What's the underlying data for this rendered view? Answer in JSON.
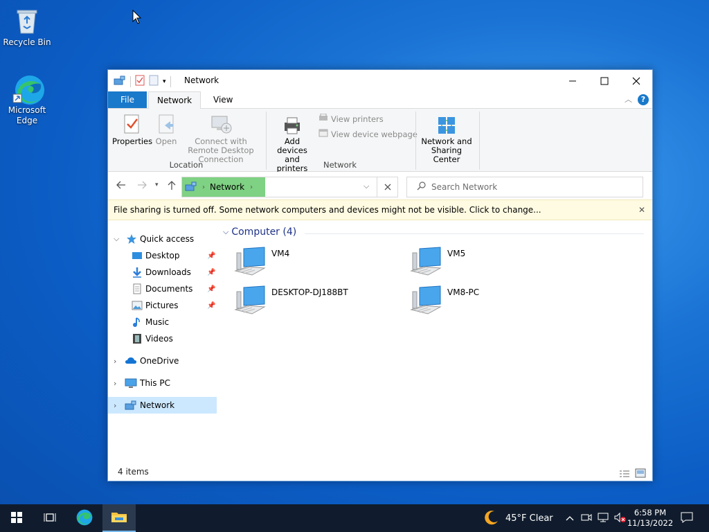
{
  "desktop": {
    "icons": [
      {
        "label": "Recycle Bin"
      },
      {
        "label": "Microsoft Edge"
      }
    ]
  },
  "window": {
    "title": "Network",
    "tabs": {
      "file": "File",
      "network": "Network",
      "view": "View"
    },
    "ribbon": {
      "properties": "Properties",
      "open": "Open",
      "connect_rdc": "Connect with Remote Desktop Connection",
      "location_group": "Location",
      "add_devices": "Add devices and printers",
      "view_printers": "View printers",
      "view_device_webpage": "View device webpage",
      "network_group": "Network",
      "network_sharing": "Network and Sharing Center"
    },
    "address": {
      "crumb": "Network",
      "search_placeholder": "Search Network"
    },
    "infobar": "File sharing is turned off. Some network computers and devices might not be visible. Click to change...",
    "nav": [
      {
        "label": "Quick access"
      },
      {
        "label": "Desktop"
      },
      {
        "label": "Downloads"
      },
      {
        "label": "Documents"
      },
      {
        "label": "Pictures"
      },
      {
        "label": "Music"
      },
      {
        "label": "Videos"
      },
      {
        "label": "OneDrive"
      },
      {
        "label": "This PC"
      },
      {
        "label": "Network"
      }
    ],
    "group_header": "Computer (4)",
    "computers": [
      {
        "name": "VM4"
      },
      {
        "name": "VM5"
      },
      {
        "name": "DESKTOP-DJ188BT"
      },
      {
        "name": "VM8-PC"
      }
    ],
    "status": "4 items"
  },
  "taskbar": {
    "weather": "45°F  Clear",
    "time": "6:58 PM",
    "date": "11/13/2022"
  },
  "colors": {
    "accent": "#1979ca",
    "crumb_bg": "#7fd183",
    "selection": "#cce8ff",
    "infobar": "#fffbe2",
    "taskbar": "#101c2d"
  }
}
